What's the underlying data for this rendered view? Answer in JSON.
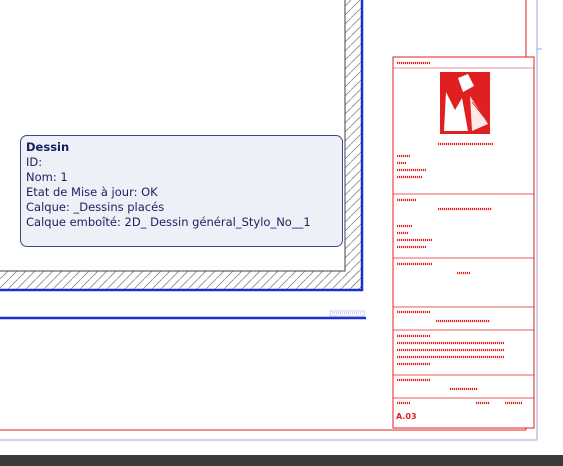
{
  "tooltip": {
    "title": "Dessin",
    "lines": [
      "ID:",
      "Nom: 1",
      "Etat de Mise à jour: OK",
      "Calque: _Dessins placés",
      "Calque emboîté: 2D_ Dessin général_Stylo_No__1"
    ]
  },
  "title_block": {
    "sheet_number": "A.03"
  },
  "colors": {
    "title_block_red": "#e02020",
    "frame_blue": "#1a2fd6",
    "tooltip_bg": "#eef0f8",
    "tooltip_text": "#1a1f5e"
  },
  "icons": {
    "logo": "red-stair-logo-icon"
  }
}
